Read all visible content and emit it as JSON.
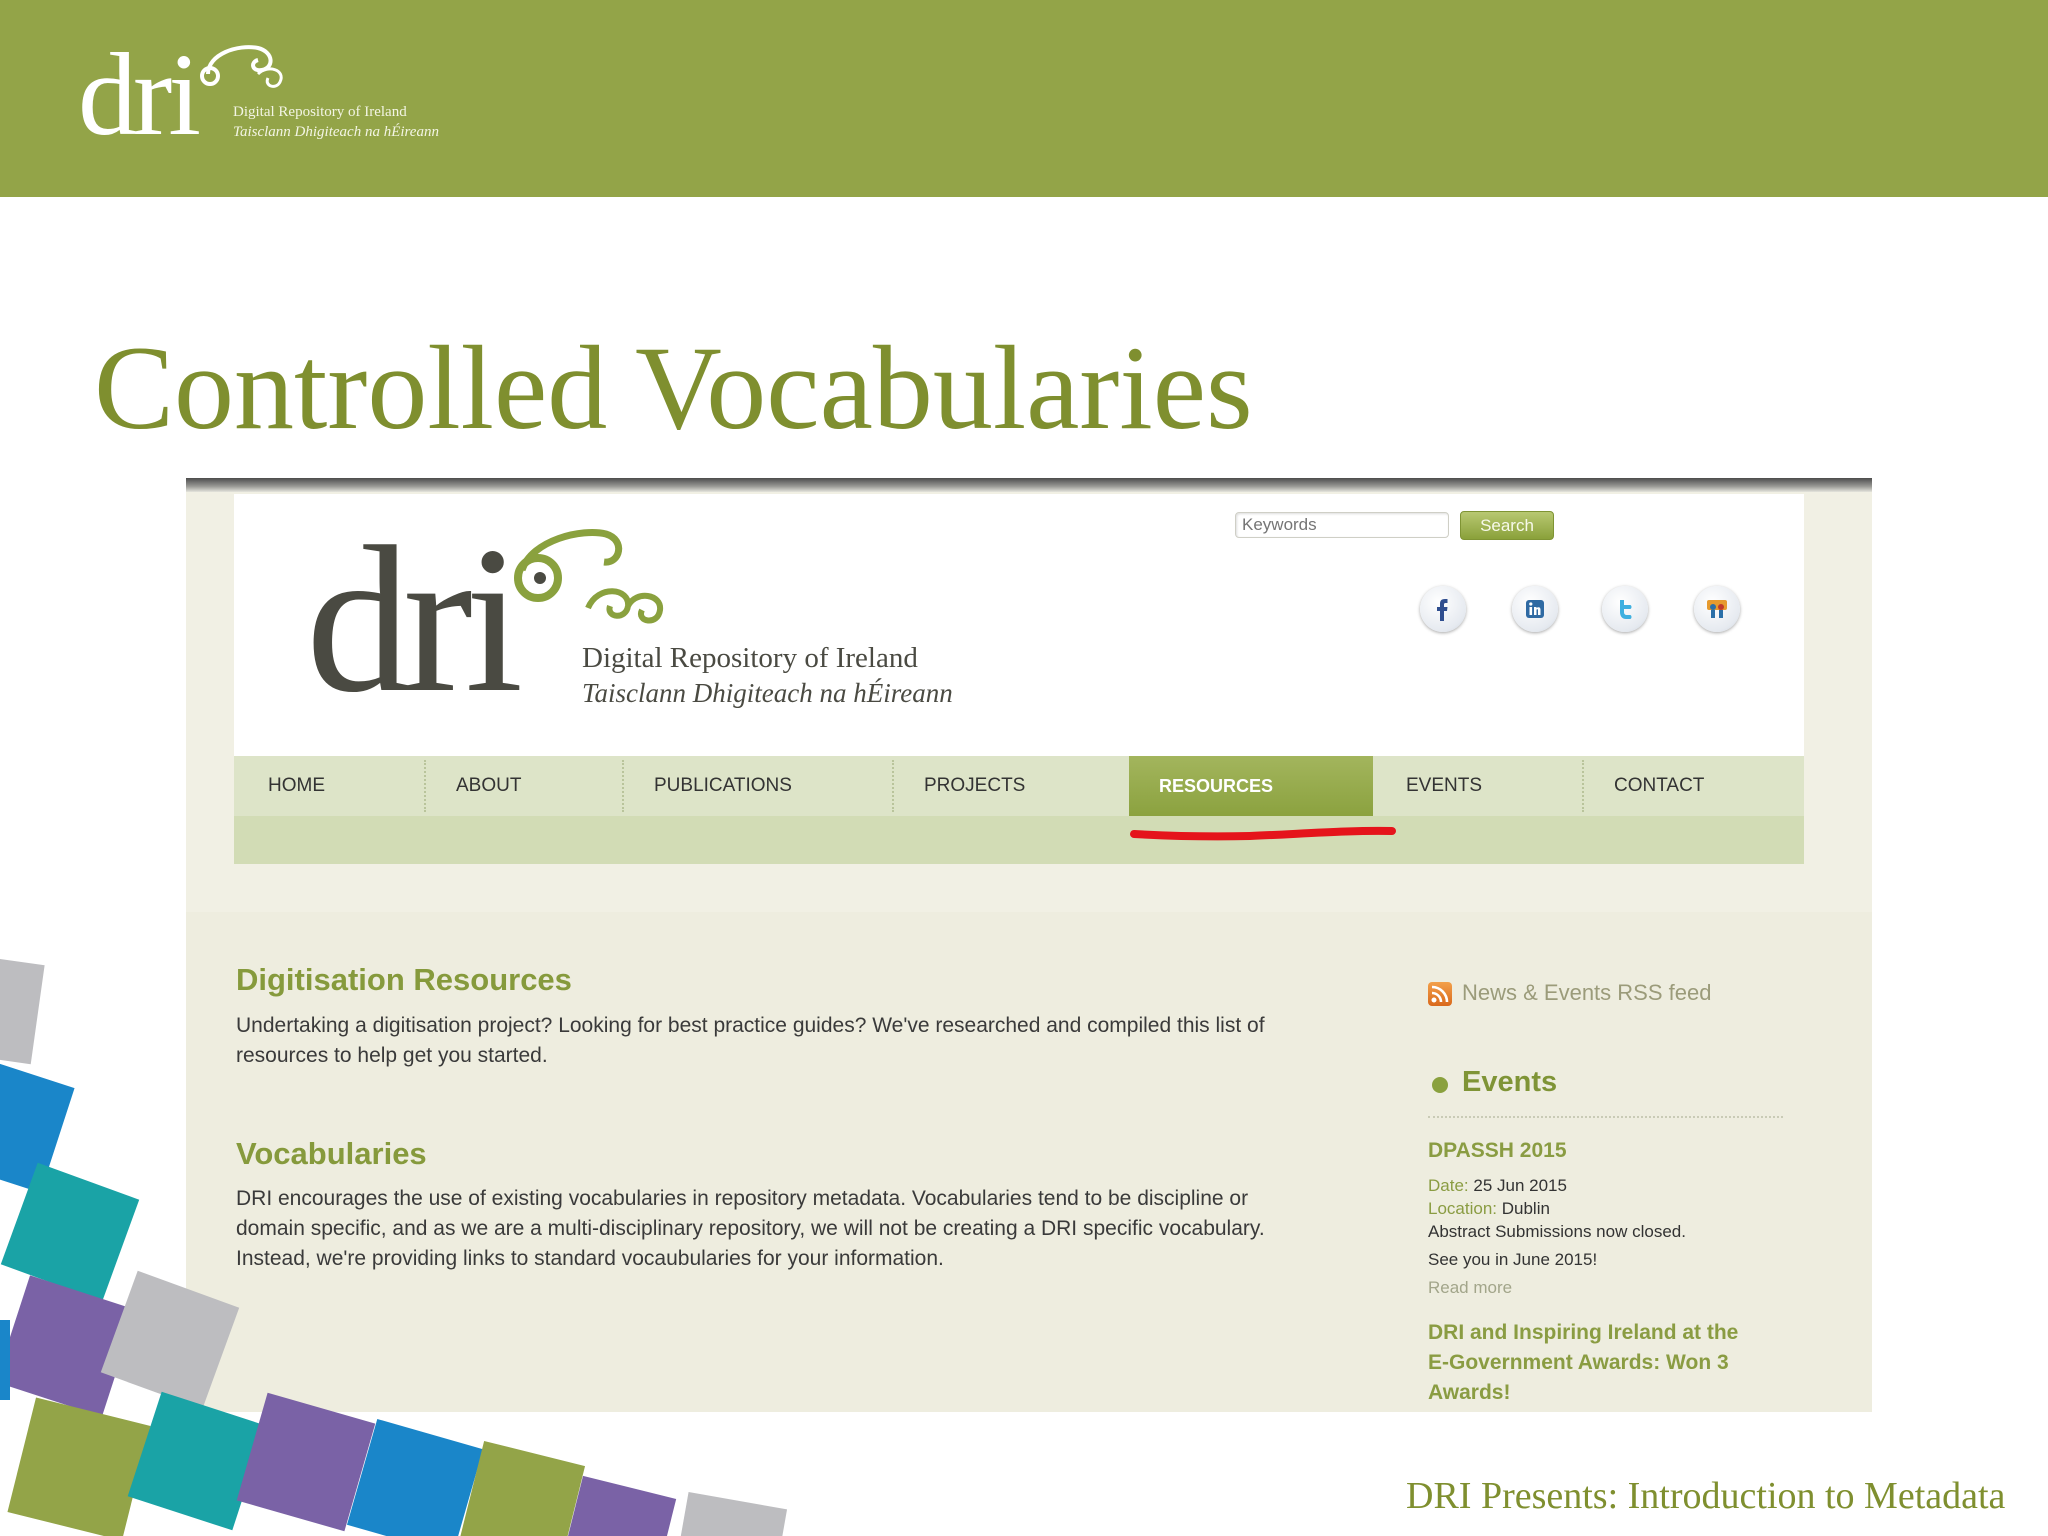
{
  "slide": {
    "title": "Controlled Vocabularies",
    "footer": "DRI Presents: Introduction to Metadata",
    "banner_logo": {
      "word": "dri",
      "line1": "Digital Repository of Ireland",
      "line2": "Taisclann Dhigiteach na hÉireann"
    }
  },
  "site": {
    "logo": {
      "word": "dri",
      "name_en": "Digital Repository of Ireland",
      "name_ga": "Taisclann Dhigiteach na hÉireann"
    },
    "search": {
      "placeholder": "Keywords",
      "button": "Search"
    },
    "social": [
      "facebook-icon",
      "linkedin-icon",
      "twitter-icon",
      "slideshare-icon"
    ],
    "nav": [
      {
        "label": "HOME"
      },
      {
        "label": "ABOUT"
      },
      {
        "label": "PUBLICATIONS"
      },
      {
        "label": "PROJECTS"
      },
      {
        "label": "RESOURCES",
        "active": true
      },
      {
        "label": "EVENTS"
      },
      {
        "label": "CONTACT"
      }
    ],
    "content": {
      "sections": [
        {
          "heading": "Digitisation Resources",
          "body": "Undertaking a digitisation project? Looking for best practice guides? We've researched and compiled this list of resources to help get you started."
        },
        {
          "heading": "Vocabularies",
          "body": "DRI encourages the use of existing vocabularies in repository metadata. Vocabularies tend to be discipline or domain specific, and as we are a multi-disciplinary repository, we will not be creating a DRI specific vocabulary. Instead, we're providing links to standard vocaubularies for your information."
        }
      ]
    },
    "sidebar": {
      "rss": "News & Events RSS feed",
      "events_heading": "Events",
      "events": [
        {
          "title": "DPASSH 2015",
          "date_label": "Date:",
          "date": "25 Jun 2015",
          "location_label": "Location:",
          "location": "Dublin",
          "note1": "Abstract Submissions now closed.",
          "note2": "See you in June 2015!",
          "read_more": "Read more"
        },
        {
          "title": "DRI and Inspiring Ireland at the E-Government Awards: Won 3 Awards!"
        }
      ]
    }
  },
  "colors": {
    "brand_green": "#93a448",
    "title_green": "#7f8f2f",
    "highlight_red": "#e5141b"
  }
}
